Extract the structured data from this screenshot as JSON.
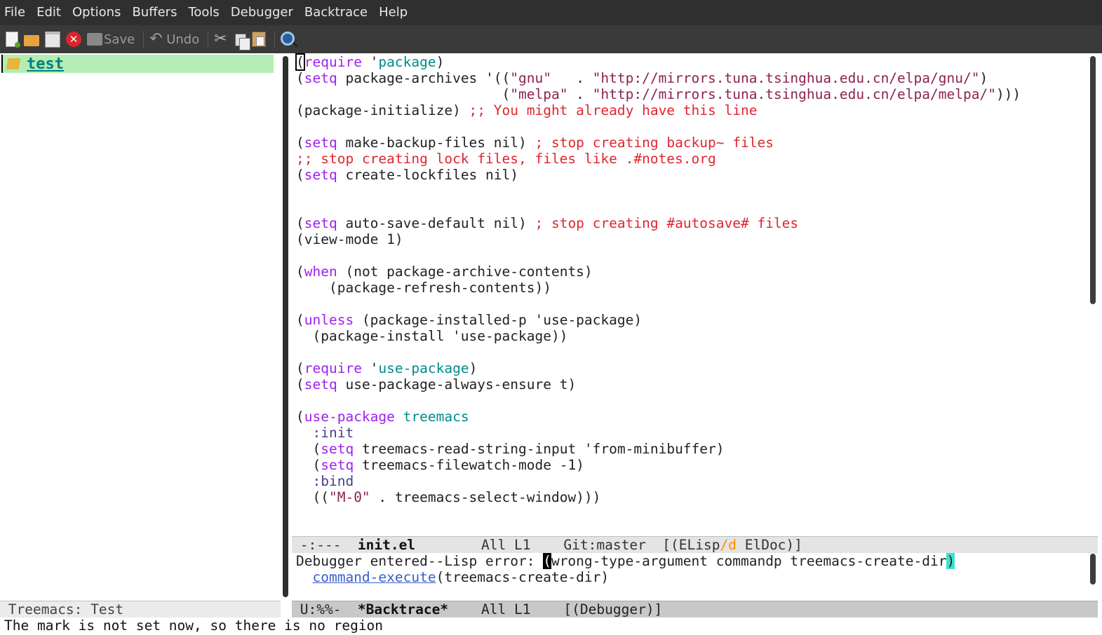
{
  "menubar": {
    "items": [
      "File",
      "Edit",
      "Options",
      "Buffers",
      "Tools",
      "Debugger",
      "Backtrace",
      "Help"
    ]
  },
  "toolbar": {
    "icons": [
      "new-file-icon",
      "open-folder-icon",
      "dired-icon",
      "close-icon",
      "save-icon",
      "undo-icon",
      "cut-icon",
      "copy-icon",
      "paste-icon",
      "search-icon"
    ],
    "save_label": "Save",
    "undo_label": "Undo",
    "close_glyph": "✕",
    "undo_glyph": "↶",
    "cut_glyph": "✂"
  },
  "treemacs": {
    "project": "test",
    "modeline": "Treemacs: Test"
  },
  "editor": {
    "lines": [
      [
        {
          "t": "(",
          "c": "cursor-box"
        },
        {
          "t": "require",
          "c": "kw"
        },
        {
          "t": " '"
        },
        {
          "t": "package",
          "c": "ref"
        },
        {
          "t": ")"
        }
      ],
      [
        {
          "t": "("
        },
        {
          "t": "setq",
          "c": "kw"
        },
        {
          "t": " package-archives '(("
        },
        {
          "t": "\"gnu\"",
          "c": "str"
        },
        {
          "t": "   . "
        },
        {
          "t": "\"http://mirrors.tuna.tsinghua.edu.cn/elpa/gnu/\"",
          "c": "str"
        },
        {
          "t": ")"
        }
      ],
      [
        {
          "t": "                         ("
        },
        {
          "t": "\"melpa\"",
          "c": "str"
        },
        {
          "t": " . "
        },
        {
          "t": "\"http://mirrors.tuna.tsinghua.edu.cn/elpa/melpa/\"",
          "c": "str"
        },
        {
          "t": ")))"
        }
      ],
      [
        {
          "t": "(package-initialize) "
        },
        {
          "t": ";; You might already have this line",
          "c": "cmt"
        }
      ],
      [
        {
          "t": ""
        }
      ],
      [
        {
          "t": "("
        },
        {
          "t": "setq",
          "c": "kw"
        },
        {
          "t": " make-backup-files nil) "
        },
        {
          "t": "; stop creating backup~ files",
          "c": "cmt"
        }
      ],
      [
        {
          "t": ";; stop creating lock files, files like .#notes.org",
          "c": "cmt"
        }
      ],
      [
        {
          "t": "("
        },
        {
          "t": "setq",
          "c": "kw"
        },
        {
          "t": " create-lockfiles nil)"
        }
      ],
      [
        {
          "t": ""
        }
      ],
      [
        {
          "t": ""
        }
      ],
      [
        {
          "t": "("
        },
        {
          "t": "setq",
          "c": "kw"
        },
        {
          "t": " auto-save-default nil) "
        },
        {
          "t": "; stop creating #autosave# files",
          "c": "cmt"
        }
      ],
      [
        {
          "t": "(view-mode 1)"
        }
      ],
      [
        {
          "t": ""
        }
      ],
      [
        {
          "t": "("
        },
        {
          "t": "when",
          "c": "kw"
        },
        {
          "t": " (not package-archive-contents)"
        }
      ],
      [
        {
          "t": "    (package-refresh-contents))"
        }
      ],
      [
        {
          "t": ""
        }
      ],
      [
        {
          "t": "("
        },
        {
          "t": "unless",
          "c": "kw"
        },
        {
          "t": " (package-installed-p 'use-package)"
        }
      ],
      [
        {
          "t": "  (package-install 'use-package))"
        }
      ],
      [
        {
          "t": ""
        }
      ],
      [
        {
          "t": "("
        },
        {
          "t": "require",
          "c": "kw"
        },
        {
          "t": " '"
        },
        {
          "t": "use-package",
          "c": "ref"
        },
        {
          "t": ")"
        }
      ],
      [
        {
          "t": "("
        },
        {
          "t": "setq",
          "c": "kw"
        },
        {
          "t": " use-package-always-ensure t)"
        }
      ],
      [
        {
          "t": ""
        }
      ],
      [
        {
          "t": "("
        },
        {
          "t": "use-package",
          "c": "kw"
        },
        {
          "t": " "
        },
        {
          "t": "treemacs",
          "c": "ref"
        }
      ],
      [
        {
          "t": "  "
        },
        {
          "t": ":init",
          "c": "const"
        }
      ],
      [
        {
          "t": "  ("
        },
        {
          "t": "setq",
          "c": "kw"
        },
        {
          "t": " treemacs-read-string-input 'from-minibuffer)"
        }
      ],
      [
        {
          "t": "  ("
        },
        {
          "t": "setq",
          "c": "kw"
        },
        {
          "t": " treemacs-filewatch-mode -1)"
        }
      ],
      [
        {
          "t": "  "
        },
        {
          "t": ":bind",
          "c": "const"
        }
      ],
      [
        {
          "t": "  (("
        },
        {
          "t": "\"M-0\"",
          "c": "str"
        },
        {
          "t": " . treemacs-select-window)))"
        }
      ]
    ]
  },
  "modeline_init": {
    "status": " -:---  ",
    "buffer": "init.el",
    "position": "        All L1    Git:master  [(ELisp",
    "slash_d": "/d",
    "rest": " ElDoc)]"
  },
  "backtrace": {
    "prefix": "Debugger entered--Lisp error: ",
    "open_paren": "(",
    "body": "wrong-type-argument commandp treemacs-create-dir",
    "close_paren": ")",
    "indent": "  ",
    "link": "command-execute",
    "call_rest": "(treemacs-create-dir)"
  },
  "modeline_backtrace": {
    "status": " U:%%-  ",
    "buffer": "*Backtrace*",
    "rest": "    All L1    [(Debugger)]"
  },
  "echo_area": "The mark is not set now, so there is no region"
}
